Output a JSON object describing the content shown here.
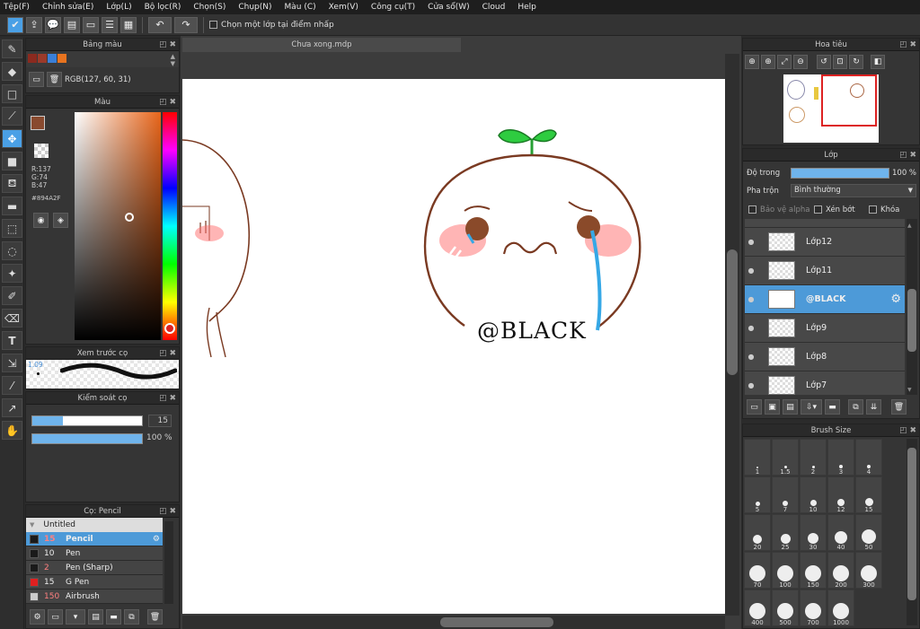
{
  "menu": [
    "Tệp(F)",
    "Chỉnh sửa(E)",
    "Lớp(L)",
    "Bộ lọc(R)",
    "Chọn(S)",
    "Chụp(N)",
    "Màu (C)",
    "Xem(V)",
    "Công cụ(T)",
    "Cửa sổ(W)",
    "Cloud",
    "Help"
  ],
  "toolbar": {
    "select_layer_label": "Chọn một lớp tại điểm nhấp"
  },
  "palette": {
    "title": "Bảng màu",
    "rgb_text": "RGB(127, 60, 31)",
    "swatches": [
      "#8b2a1f",
      "#9b3a2a",
      "#3a7fd8",
      "#e8731f"
    ]
  },
  "color": {
    "title": "Màu",
    "r": "R:137",
    "g": "G:74",
    "b": "B:47",
    "hex": "#894A2F",
    "fg": "#894A2F"
  },
  "brush_preview": {
    "title": "Xem trước cọ",
    "value": "1.09"
  },
  "brush_control": {
    "title": "Kiểm soát cọ",
    "size": "15",
    "opacity": "100 %"
  },
  "brush_list": {
    "title": "Cọ: Pencil",
    "group": "Untitled",
    "items": [
      {
        "size": "15",
        "name": "Pencil",
        "color": "#1a1a1a",
        "selected": true
      },
      {
        "size": "10",
        "name": "Pen",
        "color": "#1a1a1a",
        "selected": false
      },
      {
        "size": "2",
        "name": "Pen (Sharp)",
        "color": "#1a1a1a",
        "selected": false
      },
      {
        "size": "15",
        "name": "G Pen",
        "color": "#e02020",
        "selected": false
      },
      {
        "size": "150",
        "name": "Airbrush",
        "color": "#cccccc",
        "selected": false
      }
    ]
  },
  "canvas": {
    "tab": "Chưa xong.mdp",
    "watermark": "@BLACK"
  },
  "navigator": {
    "title": "Hoa tiêu"
  },
  "layers": {
    "title": "Lớp",
    "opacity_label": "Độ trong",
    "opacity_value": "100 %",
    "opacity": 1.0,
    "blend_label": "Pha trộn",
    "blend_value": "Bình thường",
    "protect_alpha": "Bảo vệ alpha",
    "clip": "Xén bớt",
    "lock": "Khóa",
    "items": [
      {
        "name": "Lớp12",
        "selected": false
      },
      {
        "name": "Lớp11",
        "selected": false
      },
      {
        "name": "@BLACK",
        "selected": true
      },
      {
        "name": "Lớp9",
        "selected": false
      },
      {
        "name": "Lớp8",
        "selected": false
      },
      {
        "name": "Lớp7",
        "selected": false
      }
    ]
  },
  "brush_size": {
    "title": "Brush Size",
    "sizes": [
      "1",
      "1.5",
      "2",
      "3",
      "4",
      "5",
      "7",
      "10",
      "12",
      "15",
      "20",
      "25",
      "30",
      "40",
      "50",
      "70",
      "100",
      "150",
      "200",
      "300",
      "400",
      "500",
      "700",
      "1000"
    ]
  }
}
